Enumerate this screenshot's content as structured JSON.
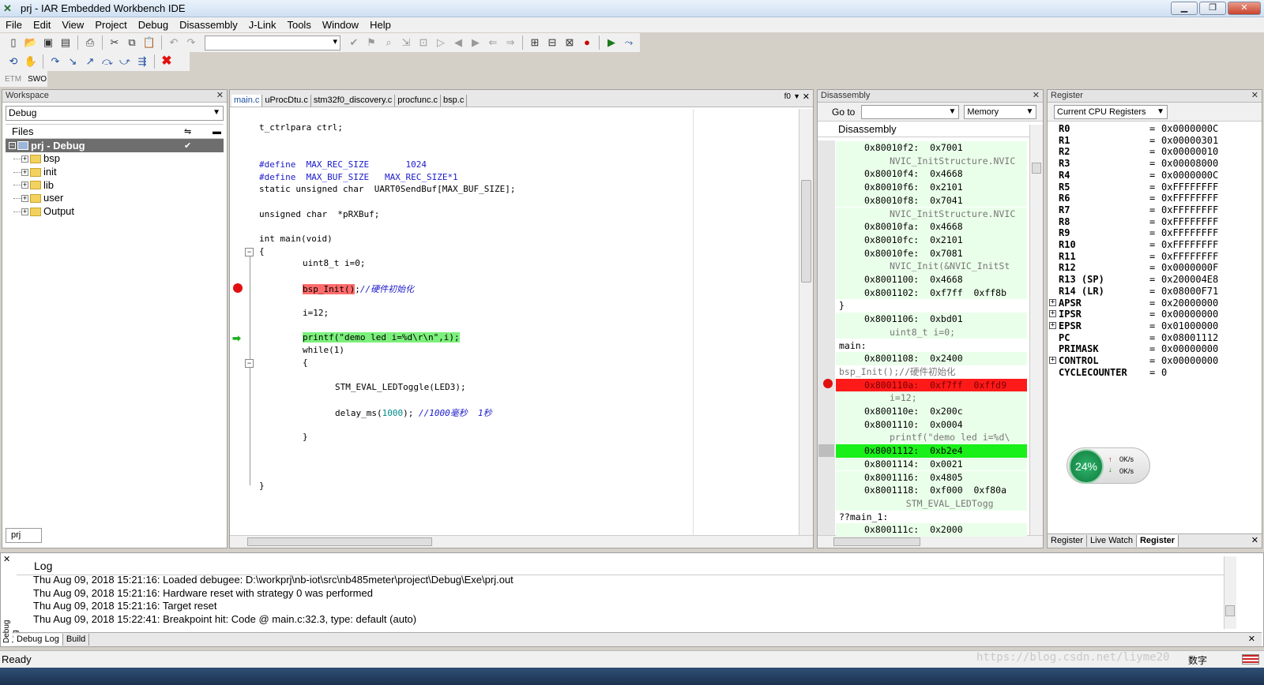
{
  "window": {
    "title": "prj - IAR Embedded Workbench IDE"
  },
  "menu": [
    "File",
    "Edit",
    "View",
    "Project",
    "Debug",
    "Disassembly",
    "J-Link",
    "Tools",
    "Window",
    "Help"
  ],
  "trace_toolbar": {
    "etm": "ETM",
    "swo": "SWO"
  },
  "workspace": {
    "header": "Workspace",
    "config": "Debug",
    "files_label": "Files",
    "project": "prj - Debug",
    "groups": [
      "bsp",
      "init",
      "lib",
      "user",
      "Output"
    ],
    "bottom_tab": "prj"
  },
  "editor": {
    "tabs": [
      "main.c",
      "uProcDtu.c",
      "stm32f0_discovery.c",
      "procfunc.c",
      "bsp.c"
    ],
    "tab_right": "f0",
    "lines": {
      "l1": "t_ctrlpara ctrl;",
      "d1_kw": "#define",
      "d1_name": "MAX_REC_SIZE",
      "d1_val": "1024",
      "d2_kw": "#define",
      "d2_name": "MAX_BUF_SIZE",
      "d2_val": "MAX_REC_SIZE*1",
      "l4": "static unsigned char  UART0SendBuf[MAX_BUF_SIZE];",
      "l5": "unsigned char  *pRXBuf;",
      "l6": "int main(void)",
      "l7": "{",
      "l8": "uint8_t i=0;",
      "l9_call": "bsp_Init()",
      "l9_semi": ";",
      "l9_cmt": "//硬件初始化",
      "l10": "i=12;",
      "l11": "printf(\"demo led i=%d\\r\\n\",i);",
      "l12": "while(1)",
      "l13": "{",
      "l14": "STM_EVAL_LEDToggle(LED3);",
      "l15_fn": "delay_ms(",
      "l15_num": "1000",
      "l15_end": ");",
      "l15_cmt": "//1000毫秒  1秒",
      "l16": "}",
      "l17": "}"
    }
  },
  "disassembly": {
    "header": "Disassembly",
    "goto_label": "Go to",
    "memory_label": "Memory",
    "title": "Disassembly",
    "lines": [
      {
        "t": "code",
        "text": "0x80010f2:  0x7001"
      },
      {
        "t": "src",
        "text": "NVIC_InitStructure.NVIC"
      },
      {
        "t": "code",
        "text": "0x80010f4:  0x4668"
      },
      {
        "t": "code",
        "text": "0x80010f6:  0x2101"
      },
      {
        "t": "code",
        "text": "0x80010f8:  0x7041"
      },
      {
        "t": "src",
        "text": "NVIC_InitStructure.NVIC"
      },
      {
        "t": "code",
        "text": "0x80010fa:  0x4668"
      },
      {
        "t": "code",
        "text": "0x80010fc:  0x2101"
      },
      {
        "t": "code",
        "text": "0x80010fe:  0x7081"
      },
      {
        "t": "src",
        "text": "NVIC_Init(&NVIC_InitSt"
      },
      {
        "t": "code",
        "text": "0x8001100:  0x4668"
      },
      {
        "t": "code",
        "text": "0x8001102:  0xf7ff  0xff8b"
      },
      {
        "t": "label",
        "text": "}"
      },
      {
        "t": "code",
        "text": "0x8001106:  0xbd01"
      },
      {
        "t": "src",
        "text": "uint8_t i=0;"
      },
      {
        "t": "label",
        "text": "main:"
      },
      {
        "t": "code",
        "text": "0x8001108:  0x2400"
      },
      {
        "t": "label",
        "text": "bsp_Init();//硬件初始化"
      },
      {
        "t": "bp",
        "text": "0x800110a:  0xf7ff  0xffd9"
      },
      {
        "t": "src",
        "text": "i=12;"
      },
      {
        "t": "code",
        "text": "0x800110e:  0x200c"
      },
      {
        "t": "code",
        "text": "0x8001110:  0x0004"
      },
      {
        "t": "src",
        "text": "printf(\"demo led i=%d\\"
      },
      {
        "t": "pc",
        "text": "0x8001112:  0xb2e4"
      },
      {
        "t": "code",
        "text": "0x8001114:  0x0021"
      },
      {
        "t": "code",
        "text": "0x8001116:  0x4805"
      },
      {
        "t": "code",
        "text": "0x8001118:  0xf000  0xf80a"
      },
      {
        "t": "src",
        "text": "   STM_EVAL_LEDTogg"
      },
      {
        "t": "label",
        "text": "??main_1:"
      },
      {
        "t": "code",
        "text": "0x800111c:  0x2000"
      }
    ]
  },
  "register": {
    "header": "Register",
    "combo": "Current CPU Registers",
    "rows": [
      {
        "n": "R0",
        "v": "0x0000000C"
      },
      {
        "n": "R1",
        "v": "0x00000301"
      },
      {
        "n": "R2",
        "v": "0x00000010"
      },
      {
        "n": "R3",
        "v": "0x00008000"
      },
      {
        "n": "R4",
        "v": "0x0000000C"
      },
      {
        "n": "R5",
        "v": "0xFFFFFFFF"
      },
      {
        "n": "R6",
        "v": "0xFFFFFFFF"
      },
      {
        "n": "R7",
        "v": "0xFFFFFFFF"
      },
      {
        "n": "R8",
        "v": "0xFFFFFFFF"
      },
      {
        "n": "R9",
        "v": "0xFFFFFFFF"
      },
      {
        "n": "R10",
        "v": "0xFFFFFFFF"
      },
      {
        "n": "R11",
        "v": "0xFFFFFFFF"
      },
      {
        "n": "R12",
        "v": "0x0000000F"
      },
      {
        "n": "R13 (SP)",
        "v": "0x200004E8"
      },
      {
        "n": "R14 (LR)",
        "v": "0x08000F71"
      },
      {
        "n": "APSR",
        "v": "0x20000000",
        "exp": true
      },
      {
        "n": "IPSR",
        "v": "0x00000000",
        "exp": true
      },
      {
        "n": "EPSR",
        "v": "0x01000000",
        "exp": true
      },
      {
        "n": "PC",
        "v": "0x08001112"
      },
      {
        "n": "PRIMASK",
        "v": "0x00000000"
      },
      {
        "n": "CONTROL",
        "v": "0x00000000",
        "exp": true
      },
      {
        "n": "CYCLECOUNTER",
        "v": "0"
      }
    ],
    "eq": "=",
    "tabs": [
      "Register",
      "Live Watch",
      "Register"
    ]
  },
  "net_widget": {
    "percent": "24%",
    "up": "0K/s",
    "down": "0K/s"
  },
  "log": {
    "title": "Log",
    "side_label": "Debug Log",
    "lines": [
      "Thu Aug 09, 2018 15:21:16: Loaded debugee: D:\\workprj\\nb-iot\\src\\nb485meter\\project\\Debug\\Exe\\prj.out",
      "Thu Aug 09, 2018 15:21:16: Hardware reset with strategy 0 was performed",
      "Thu Aug 09, 2018 15:21:16: Target reset",
      "Thu Aug 09, 2018 15:22:41: Breakpoint hit: Code @ main.c:32.3, type: default (auto)"
    ],
    "tabs": [
      "Debug Log",
      "Build"
    ]
  },
  "status": {
    "left": "Ready",
    "ime": "数字",
    "watermark": "https://blog.csdn.net/liyme20"
  }
}
